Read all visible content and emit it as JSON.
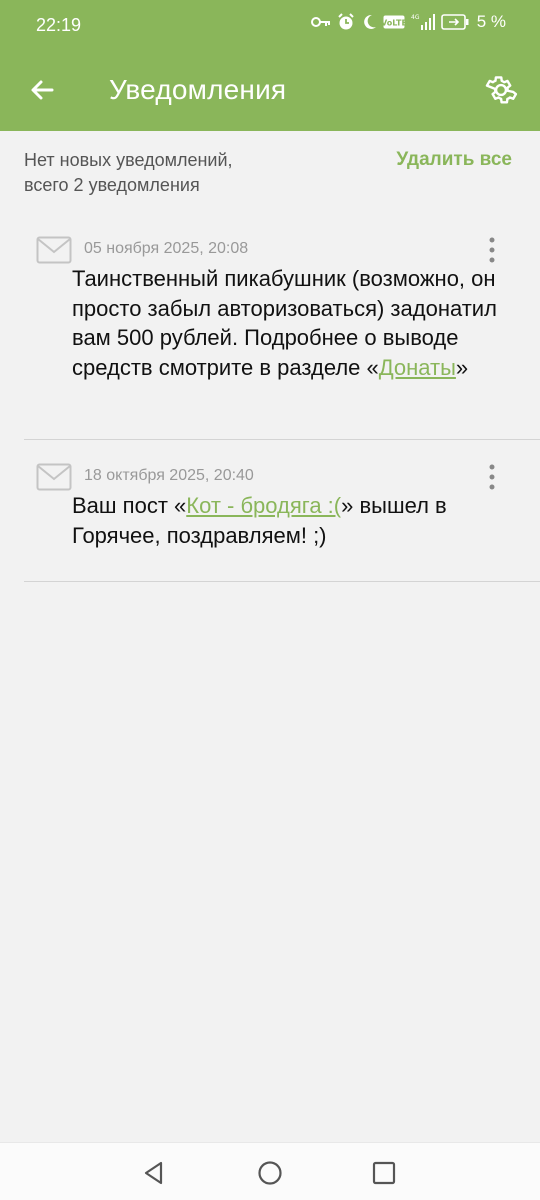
{
  "status_bar": {
    "time": "22:19",
    "battery": "5 %",
    "icons": [
      "key-icon",
      "alarm-icon",
      "moon-icon",
      "volte-icon",
      "signal-icon",
      "battery-icon"
    ]
  },
  "app_bar": {
    "title": "Уведомления",
    "color": "#8ab65a"
  },
  "summary": {
    "line1": "Нет новых уведомлений,",
    "line2": "всего 2 уведомления",
    "delete_all": "Удалить все"
  },
  "notifications": [
    {
      "date": "05 ноября 2025, 20:08",
      "text_before": "Таинственный пикабушник (возможно, он просто забыл авторизоваться) задонатил вам 500 рублей. Подробнее о выводе средств смотрите в разделе «",
      "link": "Донаты",
      "text_after": "»"
    },
    {
      "date": "18 октября 2025, 20:40",
      "text_before": "Ваш пост «",
      "link": "Кот - бродяга :(",
      "text_after": "» вышел в Горячее, поздравляем! ;)"
    }
  ]
}
